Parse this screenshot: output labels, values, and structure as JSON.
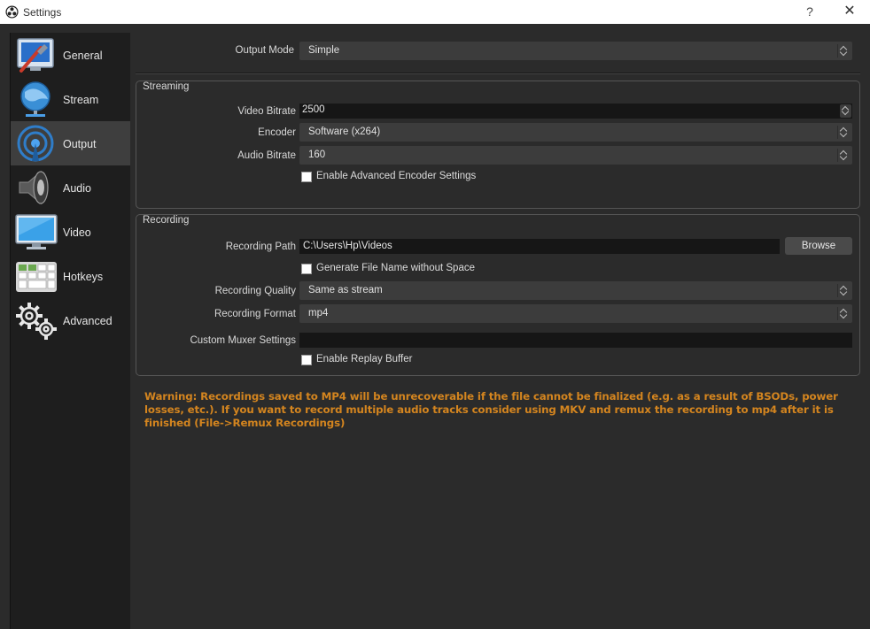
{
  "window": {
    "title": "Settings",
    "help_glyph": "?",
    "close_glyph": "✕"
  },
  "sidebar": {
    "items": [
      {
        "label": "General",
        "icon": "general-icon"
      },
      {
        "label": "Stream",
        "icon": "stream-icon"
      },
      {
        "label": "Output",
        "icon": "output-icon",
        "active": true
      },
      {
        "label": "Audio",
        "icon": "audio-icon"
      },
      {
        "label": "Video",
        "icon": "video-icon"
      },
      {
        "label": "Hotkeys",
        "icon": "hotkeys-icon"
      },
      {
        "label": "Advanced",
        "icon": "advanced-icon"
      }
    ]
  },
  "output_mode": {
    "label": "Output Mode",
    "value": "Simple"
  },
  "streaming": {
    "title": "Streaming",
    "video_bitrate": {
      "label": "Video Bitrate",
      "value": "2500"
    },
    "encoder": {
      "label": "Encoder",
      "value": "Software (x264)"
    },
    "audio_bitrate": {
      "label": "Audio Bitrate",
      "value": "160"
    },
    "advanced_encoder": {
      "label": "Enable Advanced Encoder Settings",
      "checked": false
    }
  },
  "recording": {
    "title": "Recording",
    "path": {
      "label": "Recording Path",
      "value": "C:\\Users\\Hp\\Videos"
    },
    "browse_label": "Browse",
    "no_space": {
      "label": "Generate File Name without Space",
      "checked": false
    },
    "quality": {
      "label": "Recording Quality",
      "value": "Same as stream"
    },
    "format": {
      "label": "Recording Format",
      "value": "mp4"
    },
    "muxer": {
      "label": "Custom Muxer Settings",
      "value": ""
    },
    "replay_buffer": {
      "label": "Enable Replay Buffer",
      "checked": false
    }
  },
  "warning": "Warning: Recordings saved to MP4 will be unrecoverable if the file cannot be finalized (e.g. as a result of BSODs, power losses, etc.). If you want to record multiple audio tracks consider using MKV and remux the recording to mp4 after it is finished (File->Remux Recordings)",
  "colors": {
    "warning": "#d4851f",
    "background": "#2b2b2b",
    "sidebar": "#1e1e1e",
    "active_item": "#3e3e3e"
  }
}
